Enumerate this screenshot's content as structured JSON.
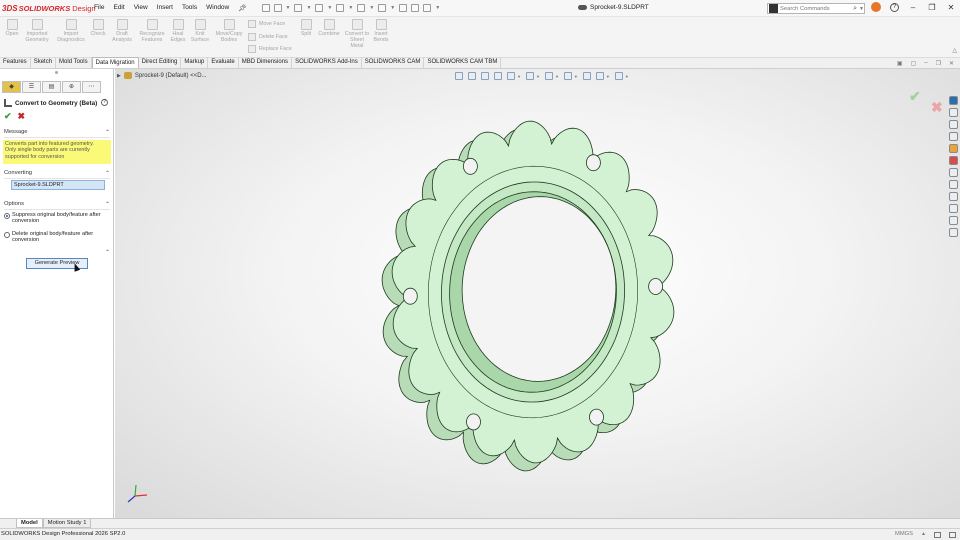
{
  "app": {
    "logo_prefix": "3DS",
    "logo_word": "SOLIDWORKS",
    "logo_suffix": "Design",
    "document_title": "Sprocket-9.SLDPRT"
  },
  "menu": [
    "File",
    "Edit",
    "View",
    "Insert",
    "Tools",
    "Window"
  ],
  "search": {
    "placeholder": "Search Commands"
  },
  "command_manager": {
    "buttons": [
      {
        "label": "Open"
      },
      {
        "label": "Imported Geometry"
      },
      {
        "label": "Import Diagnostics"
      },
      {
        "label": "Check"
      },
      {
        "label": "Draft Analysis"
      },
      {
        "label": "Recognize Features"
      },
      {
        "label": "Heal Edges"
      },
      {
        "label": "Knit Surface"
      },
      {
        "label": "Move/Copy Bodies"
      },
      {
        "label": "Split"
      },
      {
        "label": "Combine"
      },
      {
        "label": "Convert to Sheet Metal"
      },
      {
        "label": "Insert Bends"
      }
    ],
    "face_commands": [
      "Move Face",
      "Delete Face",
      "Replace Face"
    ]
  },
  "tabs": [
    {
      "label": "Features",
      "active": false
    },
    {
      "label": "Sketch",
      "active": false
    },
    {
      "label": "Mold Tools",
      "active": false
    },
    {
      "label": "Data Migration",
      "active": true
    },
    {
      "label": "Direct Editing",
      "active": false
    },
    {
      "label": "Markup",
      "active": false
    },
    {
      "label": "Evaluate",
      "active": false
    },
    {
      "label": "MBD Dimensions",
      "active": false
    },
    {
      "label": "SOLIDWORKS Add-Ins",
      "active": false
    },
    {
      "label": "SOLIDWORKS CAM",
      "active": false
    },
    {
      "label": "SOLIDWORKS CAM TBM",
      "active": false
    }
  ],
  "property_manager": {
    "title": "Convert to Geometry (Beta)",
    "message_header": "Message",
    "message_lines": [
      "Converts part into featured geometry.",
      "Only single body parts are currently",
      "supported for conversion"
    ],
    "converting_header": "Converting",
    "converting_value": "Sprocket-9.SLDPRT",
    "options_header": "Options",
    "option_1_line1": "Suppress original body/feature after",
    "option_1_line2": "conversion",
    "option_2_line1": "Delete original body/feature after",
    "option_2_line2": "conversion",
    "selected_option": 1,
    "generate_button": "Generate Preview"
  },
  "tree_flyout": {
    "label": "Sprocket-9 (Default) <<D..."
  },
  "model_tabs": [
    {
      "label": "Model",
      "active": true
    },
    {
      "label": "Motion Study 1",
      "active": false
    }
  ],
  "status": {
    "left": "SOLIDWORKS Design Professional 2026 SP2.0",
    "units": "MMGS"
  },
  "colors": {
    "part_fill": "#d3f2d3",
    "part_edge": "#1e3a1e",
    "brand": "#d8262d",
    "message_bg": "#fafa78"
  }
}
